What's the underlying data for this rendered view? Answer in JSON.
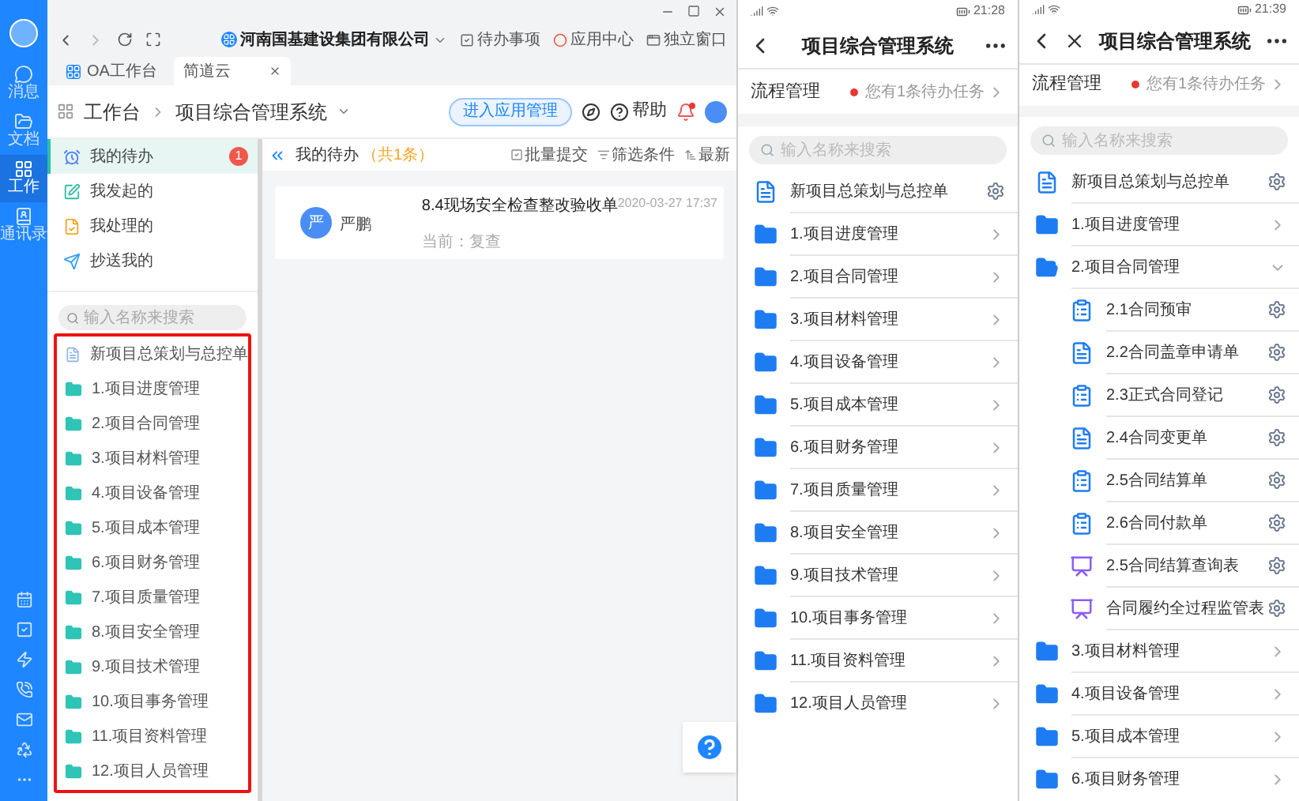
{
  "desktop": {
    "nav_rail": [
      {
        "label": "消息",
        "kind": "chat",
        "selected": false
      },
      {
        "label": "文档",
        "kind": "docs",
        "selected": false
      },
      {
        "label": "工作",
        "kind": "work",
        "selected": true
      },
      {
        "label": "通讯录",
        "kind": "contacts",
        "selected": false
      }
    ],
    "toolbar": {
      "org": "河南国基建设集团有限公司",
      "links": [
        {
          "label": "待办事项",
          "kind": "todo"
        },
        {
          "label": "应用中心",
          "kind": "apps"
        },
        {
          "label": "独立窗口",
          "kind": "window"
        }
      ]
    },
    "tabs": [
      {
        "label": "OA工作台",
        "selected": false
      },
      {
        "label": "简道云",
        "selected": true
      }
    ],
    "app_header": {
      "breadcrumb": [
        "工作台",
        "项目综合管理系统"
      ],
      "manage_button": "进入应用管理",
      "help": "帮助"
    },
    "sidebar": {
      "items": [
        {
          "label": "我的待办",
          "kind": "todo",
          "badge": "1",
          "selected": true
        },
        {
          "label": "我发起的",
          "kind": "started",
          "selected": false
        },
        {
          "label": "我处理的",
          "kind": "handled",
          "selected": false
        },
        {
          "label": "抄送我的",
          "kind": "cc",
          "selected": false
        }
      ],
      "search_placeholder": "输入名称来搜索",
      "highlighted": true,
      "tree": [
        {
          "kind": "form",
          "label": "新项目总策划与总控单"
        },
        {
          "kind": "folder",
          "label": "1.项目进度管理"
        },
        {
          "kind": "folder",
          "label": "2.项目合同管理"
        },
        {
          "kind": "folder",
          "label": "3.项目材料管理"
        },
        {
          "kind": "folder",
          "label": "4.项目设备管理"
        },
        {
          "kind": "folder",
          "label": "5.项目成本管理"
        },
        {
          "kind": "folder",
          "label": "6.项目财务管理"
        },
        {
          "kind": "folder",
          "label": "7.项目质量管理"
        },
        {
          "kind": "folder",
          "label": "8.项目安全管理"
        },
        {
          "kind": "folder",
          "label": "9.项目技术管理"
        },
        {
          "kind": "folder",
          "label": "10.项目事务管理"
        },
        {
          "kind": "folder",
          "label": "11.项目资料管理"
        },
        {
          "kind": "folder",
          "label": "12.项目人员管理"
        }
      ]
    },
    "main": {
      "title": "我的待办",
      "count": "（共1条）",
      "actions": [
        {
          "label": "批量提交",
          "kind": "batch"
        },
        {
          "label": "筛选条件",
          "kind": "filter"
        },
        {
          "label": "最新",
          "kind": "sort"
        }
      ],
      "tasks": [
        {
          "avatar": "严",
          "name": "严鹏",
          "title": "8.4现场安全检查整改验收单",
          "time": "2020-03-27 17:37",
          "current": "当前：复查"
        }
      ]
    }
  },
  "phones": [
    {
      "time": "21:28",
      "close": false,
      "title": "项目综合管理系统",
      "flow": {
        "label": "流程管理",
        "notice": "您有1条待办任务"
      },
      "search_placeholder": "输入名称来搜索",
      "items": [
        {
          "kind": "form",
          "label": "新项目总策划与总控单"
        },
        {
          "kind": "folder",
          "label": "1.项目进度管理",
          "expanded": false
        },
        {
          "kind": "folder",
          "label": "2.项目合同管理",
          "expanded": false
        },
        {
          "kind": "folder",
          "label": "3.项目材料管理",
          "expanded": false
        },
        {
          "kind": "folder",
          "label": "4.项目设备管理",
          "expanded": false
        },
        {
          "kind": "folder",
          "label": "5.项目成本管理",
          "expanded": false
        },
        {
          "kind": "folder",
          "label": "6.项目财务管理",
          "expanded": false
        },
        {
          "kind": "folder",
          "label": "7.项目质量管理",
          "expanded": false
        },
        {
          "kind": "folder",
          "label": "8.项目安全管理",
          "expanded": false
        },
        {
          "kind": "folder",
          "label": "9.项目技术管理",
          "expanded": false
        },
        {
          "kind": "folder",
          "label": "10.项目事务管理",
          "expanded": false
        },
        {
          "kind": "folder",
          "label": "11.项目资料管理",
          "expanded": false
        },
        {
          "kind": "folder",
          "label": "12.项目人员管理",
          "expanded": false
        }
      ]
    },
    {
      "time": "21:39",
      "close": true,
      "title": "项目综合管理系统",
      "flow": {
        "label": "流程管理",
        "notice": "您有1条待办任务"
      },
      "search_placeholder": "输入名称来搜索",
      "items": [
        {
          "kind": "form",
          "label": "新项目总策划与总控单"
        },
        {
          "kind": "folder",
          "label": "1.项目进度管理",
          "expanded": false
        },
        {
          "kind": "folder",
          "label": "2.项目合同管理",
          "expanded": true,
          "children": [
            {
              "kind": "flow",
              "label": "2.1合同预审"
            },
            {
              "kind": "form",
              "label": "2.2合同盖章申请单"
            },
            {
              "kind": "flow",
              "label": "2.3正式合同登记"
            },
            {
              "kind": "form",
              "label": "2.4合同变更单"
            },
            {
              "kind": "flow",
              "label": "2.5合同结算单"
            },
            {
              "kind": "flow",
              "label": "2.6合同付款单"
            },
            {
              "kind": "report",
              "label": "2.5合同结算查询表"
            },
            {
              "kind": "report",
              "label": "合同履约全过程监管表"
            }
          ]
        },
        {
          "kind": "folder",
          "label": "3.项目材料管理",
          "expanded": false
        },
        {
          "kind": "folder",
          "label": "4.项目设备管理",
          "expanded": false
        },
        {
          "kind": "folder",
          "label": "5.项目成本管理",
          "expanded": false
        },
        {
          "kind": "folder",
          "label": "6.项目财务管理",
          "expanded": false
        }
      ]
    }
  ]
}
